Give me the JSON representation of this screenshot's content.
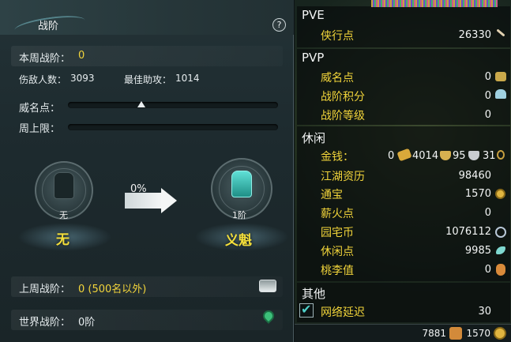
{
  "left_panel": {
    "title": "战阶",
    "help_label": "?",
    "weekly_rank": {
      "label": "本周战阶：",
      "value": "0"
    },
    "kills": {
      "label": "伤敌人数：",
      "value": "3093"
    },
    "best_assist": {
      "label": "最佳助攻：",
      "value": "1014"
    },
    "prestige_points": {
      "label": "威名点：",
      "progress": 0.35
    },
    "weekly_cap": {
      "label": "周上限：",
      "progress": 0
    },
    "current_rank": {
      "rank_text": "无",
      "name": "无"
    },
    "next_rank": {
      "rank_text": "1阶",
      "name": "义魁"
    },
    "progress_percent": "0%",
    "last_week_rank": {
      "label": "上周战阶：",
      "value": "0 (500名以外)"
    },
    "world_rank": {
      "label": "世界战阶：",
      "value": "0阶"
    }
  },
  "right_panel": {
    "pve": {
      "header": "PVE",
      "items": [
        {
          "label": "侠行点",
          "value": "26330",
          "icon": "sword-icon"
        }
      ]
    },
    "pvp": {
      "header": "PVP",
      "items": [
        {
          "label": "威名点",
          "value": "0",
          "icon": "badge-icon"
        },
        {
          "label": "战阶积分",
          "value": "0",
          "icon": "crystal-icon"
        },
        {
          "label": "战阶等级",
          "value": "0",
          "icon": ""
        }
      ]
    },
    "leisure": {
      "header": "休闲",
      "money": {
        "label": "金钱：",
        "prefix": "0",
        "gold": "4014",
        "silver": "95",
        "copper": "31"
      },
      "items": [
        {
          "label": "江湖资历",
          "value": "98460",
          "icon": ""
        },
        {
          "label": "通宝",
          "value": "1570",
          "icon": "coin-icon"
        },
        {
          "label": "薪火点",
          "value": "0",
          "icon": ""
        },
        {
          "label": "园宅币",
          "value": "1076112",
          "icon": "swirl-coin-icon"
        },
        {
          "label": "休闲点",
          "value": "9985",
          "icon": "wave-icon"
        },
        {
          "label": "桃李值",
          "value": "0",
          "icon": "gourd-icon"
        }
      ]
    },
    "other": {
      "header": "其他",
      "network": {
        "label": "网络延迟",
        "value": "30",
        "checked": true
      }
    },
    "footer": {
      "value1": "7881",
      "value2": "1570"
    },
    "colors": {
      "label_yellow": "#f1d43a",
      "accent_teal": "#4fd0c8"
    }
  }
}
